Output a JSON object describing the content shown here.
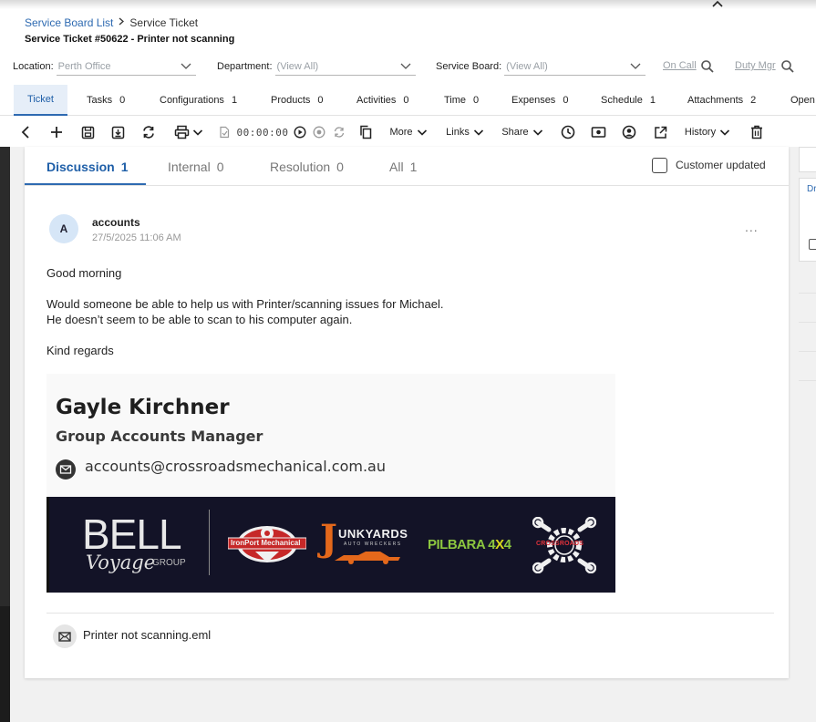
{
  "breadcrumb": {
    "parent": "Service Board List",
    "current": "Service Ticket"
  },
  "page_title": "Service Ticket #50622 - Printer not scanning",
  "filters": {
    "location_label": "Location:",
    "location_value": "Perth Office",
    "department_label": "Department:",
    "department_value": "(View All)",
    "board_label": "Service Board:",
    "board_value": "(View All)",
    "on_call": "On Call",
    "duty_mgr": "Duty Mgr"
  },
  "tabs": [
    {
      "label": "Ticket",
      "count": ""
    },
    {
      "label": "Tasks",
      "count": "0"
    },
    {
      "label": "Configurations",
      "count": "1"
    },
    {
      "label": "Products",
      "count": "0"
    },
    {
      "label": "Activities",
      "count": "0"
    },
    {
      "label": "Time",
      "count": "0"
    },
    {
      "label": "Expenses",
      "count": "0"
    },
    {
      "label": "Schedule",
      "count": "1"
    },
    {
      "label": "Attachments",
      "count": "2"
    },
    {
      "label": "Open",
      "count": ""
    }
  ],
  "toolbar": {
    "timer": "00:00:00",
    "more": "More",
    "links": "Links",
    "share": "Share",
    "history": "History"
  },
  "notes_tabs": [
    {
      "label": "Discussion",
      "count": "1"
    },
    {
      "label": "Internal",
      "count": "0"
    },
    {
      "label": "Resolution",
      "count": "0"
    },
    {
      "label": "All",
      "count": "1"
    }
  ],
  "customer_updated": "Customer updated",
  "right_panel": {
    "label": "Dr"
  },
  "note": {
    "avatar_initial": "A",
    "author": "accounts",
    "timestamp": "27/5/2025 11:06 AM",
    "more": "...",
    "lines": [
      "Good morning",
      "Would someone be able to help us with Printer/scanning issues for Michael.",
      "He doesn’t seem to be able to scan to his computer again.",
      "Kind regards"
    ],
    "signature": {
      "name": "Gayle Kirchner",
      "role": "Group Accounts Manager",
      "email": "accounts@crossroadsmechanical.com.au"
    },
    "logos": {
      "bell": "BELL",
      "voyage": "Voyage",
      "group": "GROUP",
      "ironport": "IronPort Mechanical",
      "junkyards_j": "J",
      "junkyards": "UNKYARDS",
      "junkyards_sub": "AUTO WRECKERS",
      "pilbara": "PILBARA 4",
      "pilbara_x": "X",
      "pilbara_4": "4",
      "crossroads": "CROSSROADS"
    },
    "attachment": "Printer not scanning.eml"
  }
}
